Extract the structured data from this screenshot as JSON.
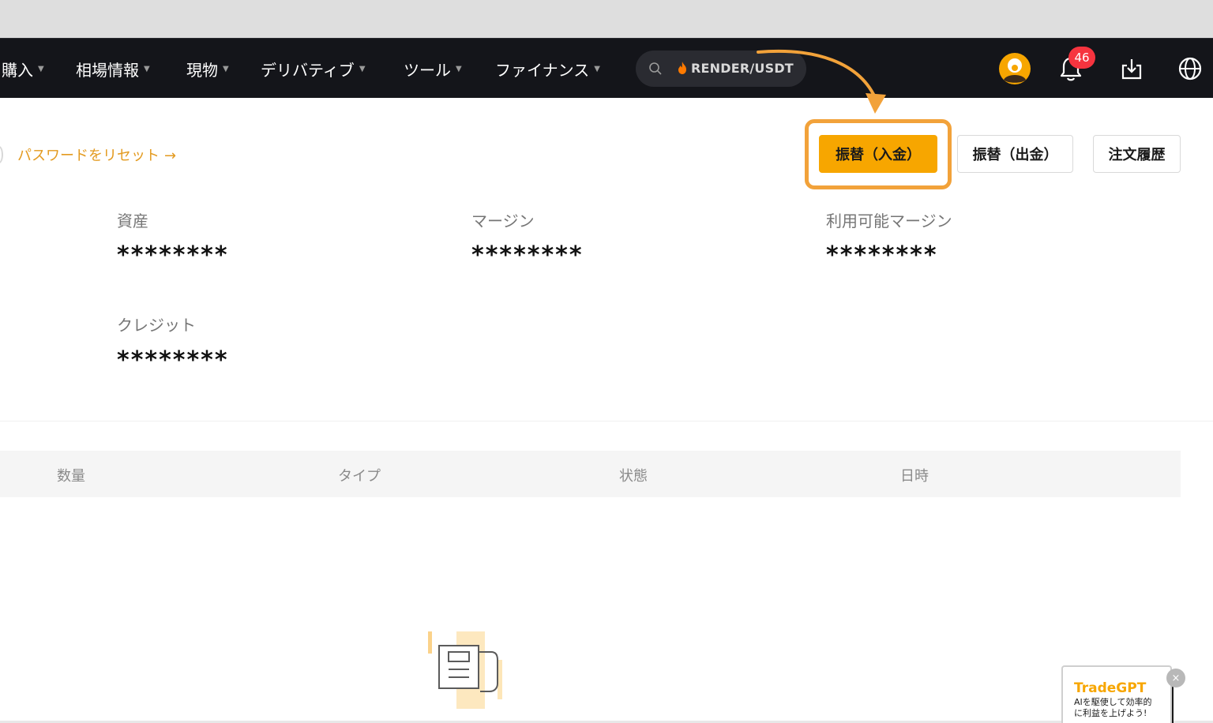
{
  "nav": {
    "items": [
      {
        "label": "購入",
        "has_menu": true
      },
      {
        "label": "相場情報",
        "has_menu": true
      },
      {
        "label": "現物",
        "has_menu": true
      },
      {
        "label": "デリバティブ",
        "has_menu": true
      },
      {
        "label": "ツール",
        "has_menu": true
      },
      {
        "label": "ファイナンス",
        "has_menu": true
      }
    ],
    "caret": "▼",
    "search_text": "RENDER/USDT",
    "search_icon": "search-icon",
    "hot_icon": "fire-icon",
    "notification_count": "46",
    "icons": [
      "avatar",
      "bell-icon",
      "download-icon",
      "globe-icon"
    ]
  },
  "account": {
    "reset_password_link": "パスワードをリセット",
    "reset_arrow": "→"
  },
  "actions": {
    "deposit": "振替（入金）",
    "withdraw": "振替（出金）",
    "order_history": "注文履歴"
  },
  "stats": {
    "assets_label": "資産",
    "assets_value": "********",
    "margin_label": "マージン",
    "margin_value": "********",
    "available_margin_label": "利用可能マージン",
    "available_margin_value": "********",
    "credit_label": "クレジット",
    "credit_value": "********"
  },
  "table": {
    "columns": [
      "数量",
      "タイプ",
      "状態",
      "日時"
    ]
  },
  "tradegpt": {
    "title": "TradeGPT",
    "line1": "AIを駆使して効率的",
    "line2": "に利益を上げよう!",
    "close": "×"
  },
  "colors": {
    "accent": "#f7a600",
    "highlight": "#f2a23a",
    "nav_bg": "#14151a",
    "badge": "#f6343f"
  }
}
